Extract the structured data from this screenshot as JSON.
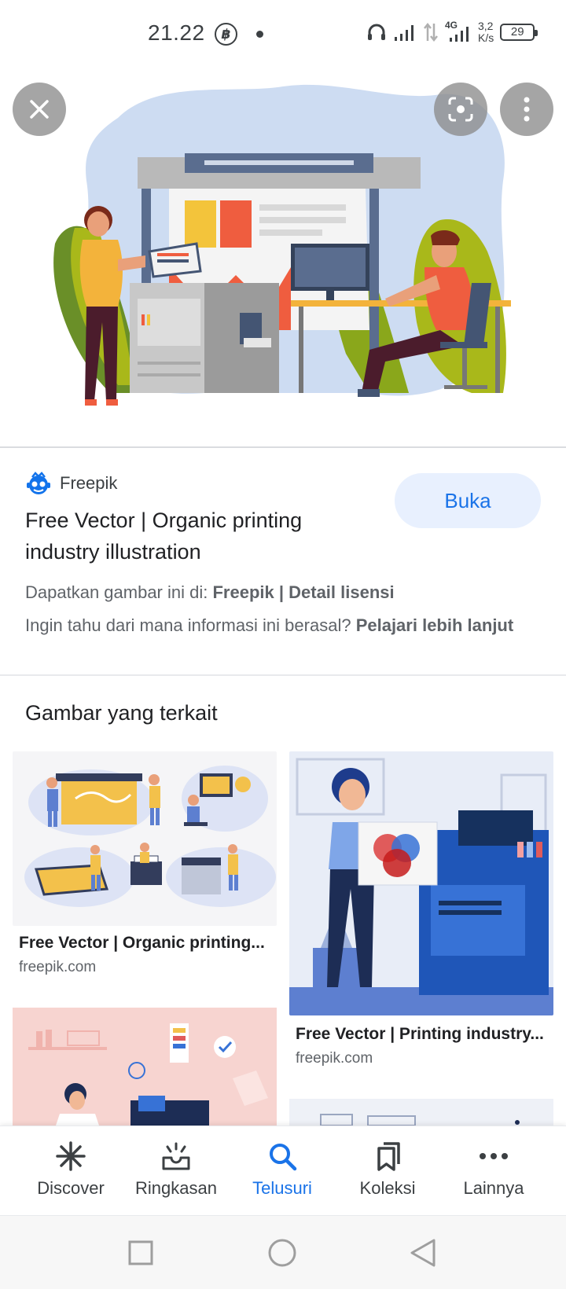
{
  "status_bar": {
    "time": "21.22",
    "coin_glyph": "฿",
    "network": "4G",
    "speed_value": "3,2",
    "speed_unit": "K/s",
    "battery": "29"
  },
  "hero": {
    "close_icon": "close-icon",
    "lens_icon": "lens-icon",
    "more_icon": "more-vert-icon"
  },
  "info": {
    "source_name": "Freepik",
    "open_button": "Buka",
    "title": "Free Vector | Organic printing industry illustration",
    "license_prefix": "Dapatkan gambar ini di: ",
    "license_source": "Freepik",
    "license_sep": " | ",
    "license_detail": "Detail lisensi",
    "learn_prefix": "Ingin tahu dari mana informasi ini berasal? ",
    "learn_link": "Pelajari lebih lanjut"
  },
  "related": {
    "heading": "Gambar yang terkait",
    "items": [
      {
        "title": "Free Vector | Organic printing...",
        "domain": "freepik.com"
      },
      {
        "title": "Free Vector | Printing industry...",
        "domain": "freepik.com"
      }
    ]
  },
  "bottom_nav": {
    "items": [
      {
        "label": "Discover",
        "icon": "asterisk-icon"
      },
      {
        "label": "Ringkasan",
        "icon": "summary-icon"
      },
      {
        "label": "Telusuri",
        "icon": "search-icon"
      },
      {
        "label": "Koleksi",
        "icon": "bookmarks-icon"
      },
      {
        "label": "Lainnya",
        "icon": "more-horiz-icon"
      }
    ],
    "active": "Telusuri"
  },
  "colors": {
    "accent": "#1a73e8",
    "accent_bg": "#e8f0fe",
    "text_primary": "#202124",
    "text_secondary": "#5f6368"
  }
}
